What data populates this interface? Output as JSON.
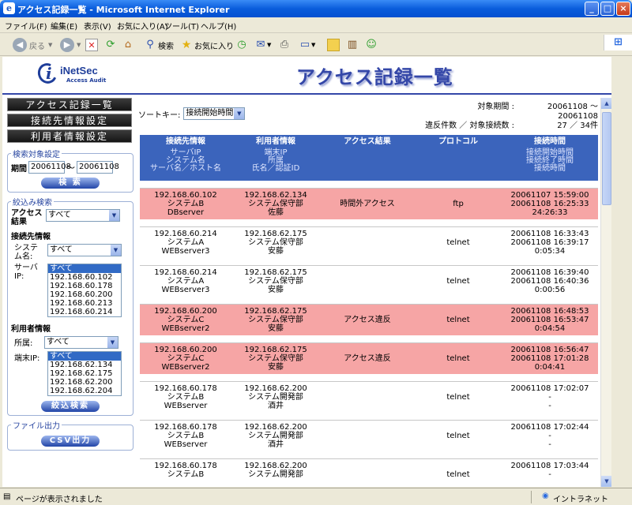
{
  "window": {
    "title": "アクセス記録一覧 - Microsoft Internet Explorer",
    "min": "_",
    "max": "□",
    "close": "×"
  },
  "menu": [
    "ファイル(F)",
    "編集(E)",
    "表示(V)",
    "お気に入り(A)",
    "ツール(T)",
    "ヘルプ(H)"
  ],
  "toolbar": {
    "back": "戻る",
    "search": "検索",
    "favorites": "お気に入り"
  },
  "logo": {
    "brand": "iNetSec",
    "sub": "Access Audit"
  },
  "page_title": "アクセス記録一覧",
  "nav": [
    "アクセス記録一覧",
    "接続先情報設定",
    "利用者情報設定"
  ],
  "search_box": {
    "legend": "検索対象設定",
    "period_label": "期間",
    "from": "20061108",
    "sep": "～",
    "to": "20061108",
    "button": "検 索"
  },
  "filter_box": {
    "legend": "絞込み検索",
    "access_result_label": "アクセス結果",
    "access_result_value": "すべて",
    "dest_section": "接続先情報",
    "system_label": "システム名:",
    "system_value": "すべて",
    "server_ip_label": "サーバIP:",
    "server_ip_options": [
      "すべて",
      "192.168.60.102",
      "192.168.60.178",
      "192.168.60.200",
      "192.168.60.213",
      "192.168.60.214"
    ],
    "user_section": "利用者情報",
    "dept_label": "所属:",
    "dept_value": "すべて",
    "term_ip_label": "端末IP:",
    "term_ip_options": [
      "すべて",
      "192.168.62.134",
      "192.168.62.175",
      "192.168.62.200",
      "192.168.62.204"
    ],
    "button": "絞込検索"
  },
  "file_box": {
    "legend": "ファイル出力",
    "button": "CSV出力"
  },
  "sort": {
    "label": "ソートキー:",
    "value": "接続開始時間"
  },
  "meta": {
    "period_label": "対象期間 :",
    "period_value": "20061108 ～ 20061108",
    "count_label": "違反件数 ／ 対象接続数 :",
    "count_value": "27 ／ 34件"
  },
  "columns": [
    {
      "title": "接続先情報",
      "sub": [
        "サーバIP",
        "システム名",
        "サーバ名／ホスト名"
      ]
    },
    {
      "title": "利用者情報",
      "sub": [
        "端末IP",
        "所属",
        "氏名／認証ID"
      ]
    },
    {
      "title": "アクセス結果",
      "sub": []
    },
    {
      "title": "プロトコル",
      "sub": []
    },
    {
      "title": "接続時間",
      "sub": [
        "接続開始時間",
        "接続終了時間",
        "接続時間"
      ]
    }
  ],
  "rows": [
    {
      "violation": true,
      "dest": [
        "192.168.60.102",
        "システムB",
        "DBserver"
      ],
      "user": [
        "192.168.62.134",
        "システム保守部",
        "佐藤"
      ],
      "result": "時間外アクセス",
      "protocol": "ftp",
      "time": [
        "20061107 15:59:00",
        "20061108 16:25:33",
        "24:26:33"
      ]
    },
    {
      "violation": false,
      "dest": [
        "192.168.60.214",
        "システムA",
        "WEBserver3"
      ],
      "user": [
        "192.168.62.175",
        "システム保守部",
        "安藤"
      ],
      "result": "",
      "protocol": "telnet",
      "time": [
        "20061108 16:33:43",
        "20061108 16:39:17",
        "0:05:34"
      ]
    },
    {
      "violation": false,
      "dest": [
        "192.168.60.214",
        "システムA",
        "WEBserver3"
      ],
      "user": [
        "192.168.62.175",
        "システム保守部",
        "安藤"
      ],
      "result": "",
      "protocol": "telnet",
      "time": [
        "20061108 16:39:40",
        "20061108 16:40:36",
        "0:00:56"
      ]
    },
    {
      "violation": true,
      "dest": [
        "192.168.60.200",
        "システムC",
        "WEBserver2"
      ],
      "user": [
        "192.168.62.175",
        "システム保守部",
        "安藤"
      ],
      "result": "アクセス違反",
      "protocol": "telnet",
      "time": [
        "20061108 16:48:53",
        "20061108 16:53:47",
        "0:04:54"
      ]
    },
    {
      "violation": true,
      "dest": [
        "192.168.60.200",
        "システムC",
        "WEBserver2"
      ],
      "user": [
        "192.168.62.175",
        "システム保守部",
        "安藤"
      ],
      "result": "アクセス違反",
      "protocol": "telnet",
      "time": [
        "20061108 16:56:47",
        "20061108 17:01:28",
        "0:04:41"
      ]
    },
    {
      "violation": false,
      "dest": [
        "192.168.60.178",
        "システムB",
        "WEBserver"
      ],
      "user": [
        "192.168.62.200",
        "システム開発部",
        "酒井"
      ],
      "result": "",
      "protocol": "telnet",
      "time": [
        "20061108 17:02:07",
        "-",
        "-"
      ]
    },
    {
      "violation": false,
      "dest": [
        "192.168.60.178",
        "システムB",
        "WEBserver"
      ],
      "user": [
        "192.168.62.200",
        "システム開発部",
        "酒井"
      ],
      "result": "",
      "protocol": "telnet",
      "time": [
        "20061108 17:02:44",
        "-",
        "-"
      ]
    },
    {
      "violation": false,
      "dest": [
        "192.168.60.178",
        "システムB",
        ""
      ],
      "user": [
        "192.168.62.200",
        "システム開発部",
        ""
      ],
      "result": "",
      "protocol": "telnet",
      "time": [
        "20061108 17:03:44",
        "-",
        ""
      ]
    }
  ],
  "status": {
    "text": "ページが表示されました",
    "zone": "イントラネット"
  },
  "colors": {
    "violation_row": "#f6a5a5",
    "header_blue": "#3b64bc",
    "xp_title": "#0A5DDC"
  }
}
